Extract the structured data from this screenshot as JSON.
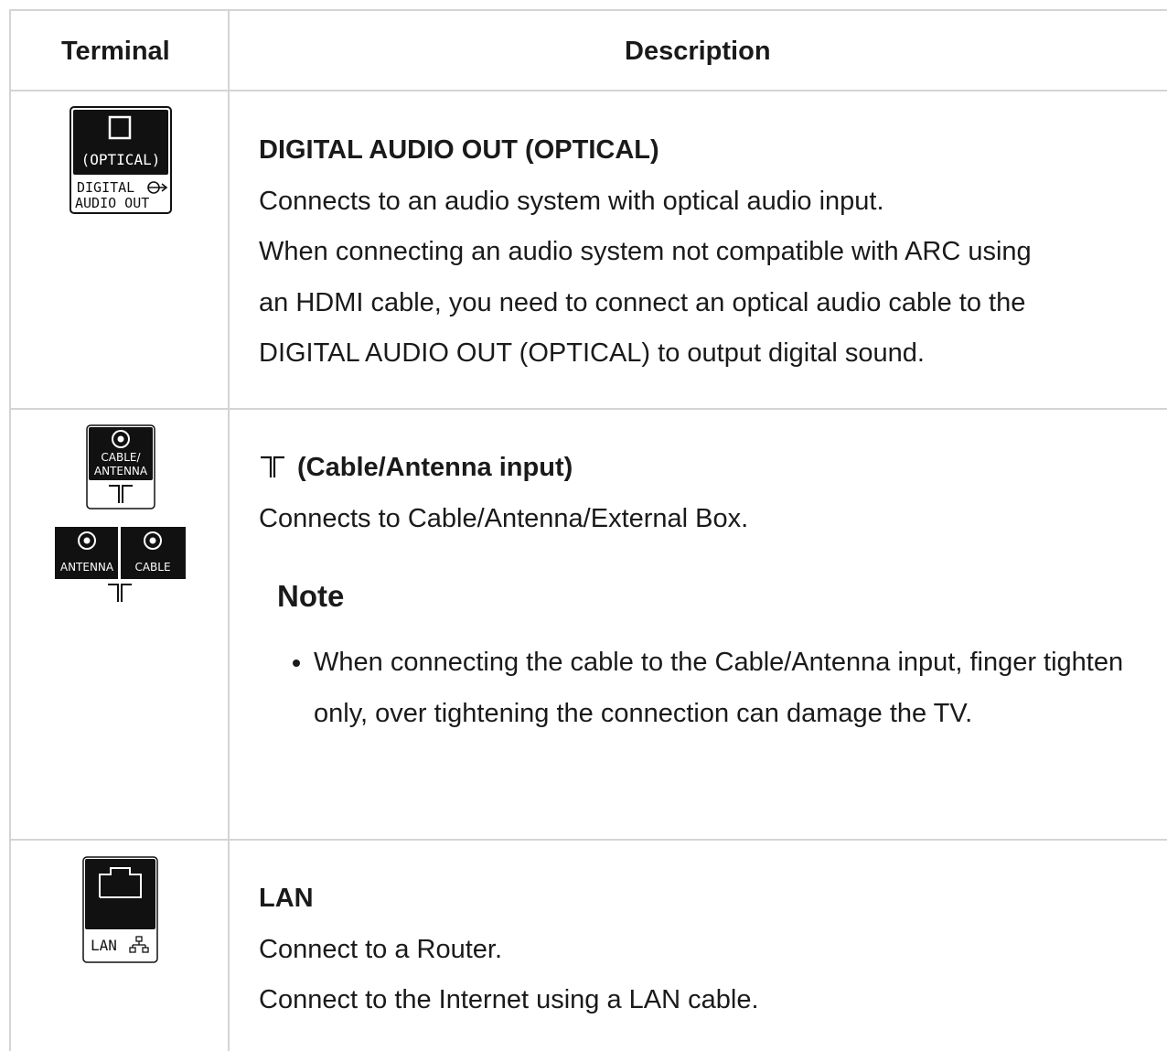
{
  "header": {
    "terminal": "Terminal",
    "description": "Description"
  },
  "rows": [
    {
      "icon": {
        "name": "optical-port-icon",
        "label_line1": "(OPTICAL)",
        "label_line2": "DIGITAL",
        "label_line3": "AUDIO OUT"
      },
      "title": "DIGITAL AUDIO OUT (OPTICAL)",
      "lines": [
        "Connects to an audio system with optical audio input.",
        "When connecting an audio system not compatible with ARC using",
        "an HDMI cable, you need to connect an optical audio cable to the",
        "DIGITAL AUDIO OUT (OPTICAL) to output digital sound."
      ]
    },
    {
      "icon": {
        "name": "antenna-port-icon",
        "single_label_line1": "CABLE/",
        "single_label_line2": "ANTENNA",
        "left_label": "ANTENNA",
        "right_label": "CABLE"
      },
      "title": "(Cable/Antenna input)",
      "lines": [
        "Connects to Cable/Antenna/External Box."
      ],
      "note": {
        "heading": "Note",
        "items": [
          "When connecting the cable to the Cable/Antenna input, finger tighten only, over tightening the connection can damage the TV."
        ]
      }
    },
    {
      "icon": {
        "name": "lan-port-icon",
        "label": "LAN"
      },
      "title": "LAN",
      "lines": [
        "Connect to a Router.",
        "Connect to the Internet using a LAN cable."
      ]
    }
  ]
}
